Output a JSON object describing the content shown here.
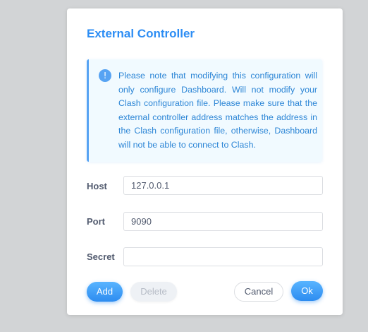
{
  "dialog": {
    "title": "External Controller",
    "notice": {
      "icon": "info-icon",
      "icon_glyph": "!",
      "text": "Please note that modifying this configuration will only configure Dashboard. Will not modify your Clash configuration file. Please make sure that the external controller address matches the address in the Clash configuration file, otherwise, Dashboard will not be able to connect to Clash."
    },
    "fields": {
      "host": {
        "label": "Host",
        "value": "127.0.0.1"
      },
      "port": {
        "label": "Port",
        "value": "9090"
      },
      "secret": {
        "label": "Secret",
        "value": ""
      }
    },
    "buttons": {
      "add": "Add",
      "delete": "Delete",
      "cancel": "Cancel",
      "ok": "Ok"
    }
  },
  "colors": {
    "accent": "#2c8df4",
    "notice_bg": "#f1faff",
    "notice_border": "#57a3f3",
    "overlay": "#d2d4d6"
  }
}
